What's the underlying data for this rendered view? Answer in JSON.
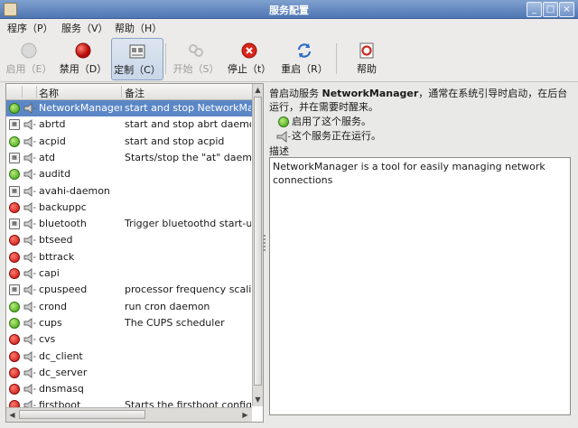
{
  "window": {
    "title": "服务配置",
    "controls": [
      "_",
      "□",
      "×"
    ]
  },
  "menu": [
    {
      "label": "程序（P）"
    },
    {
      "label": "服务（V）"
    },
    {
      "label": "帮助（H）"
    }
  ],
  "toolbar": {
    "enable": {
      "label": "启用（E）",
      "icon": "enable-icon"
    },
    "disable": {
      "label": "禁用（D）",
      "icon": "disable-icon"
    },
    "customize": {
      "label": "定制（C）",
      "icon": "customize-icon"
    },
    "start": {
      "label": "开始（S）",
      "icon": "start-icon"
    },
    "stop": {
      "label": "停止（t）",
      "icon": "stop-icon"
    },
    "restart": {
      "label": "重启（R）",
      "icon": "restart-icon"
    },
    "help": {
      "label": "帮助",
      "icon": "help-icon"
    }
  },
  "list": {
    "headers": {
      "name": "名称",
      "remarks": "备注"
    },
    "rows": [
      {
        "status": "green",
        "name": "NetworkManager",
        "desc": "start and stop NetworkManager",
        "selected": true
      },
      {
        "status": "box",
        "name": "abrtd",
        "desc": "start and stop abrt daemon"
      },
      {
        "status": "green",
        "name": "acpid",
        "desc": "start and stop acpid"
      },
      {
        "status": "box",
        "name": "atd",
        "desc": "Starts/stop the \"at\" daemon"
      },
      {
        "status": "green",
        "name": "auditd",
        "desc": ""
      },
      {
        "status": "box",
        "name": "avahi-daemon",
        "desc": ""
      },
      {
        "status": "red",
        "name": "backuppc",
        "desc": ""
      },
      {
        "status": "box",
        "name": "bluetooth",
        "desc": "Trigger bluetoothd start-up"
      },
      {
        "status": "red",
        "name": "btseed",
        "desc": ""
      },
      {
        "status": "red",
        "name": "bttrack",
        "desc": ""
      },
      {
        "status": "red",
        "name": "capi",
        "desc": ""
      },
      {
        "status": "box",
        "name": "cpuspeed",
        "desc": "processor frequency scaling"
      },
      {
        "status": "green",
        "name": "crond",
        "desc": "run cron daemon"
      },
      {
        "status": "green",
        "name": "cups",
        "desc": "The CUPS scheduler"
      },
      {
        "status": "red",
        "name": "cvs",
        "desc": ""
      },
      {
        "status": "red",
        "name": "dc_client",
        "desc": ""
      },
      {
        "status": "red",
        "name": "dc_server",
        "desc": ""
      },
      {
        "status": "red",
        "name": "dnsmasq",
        "desc": ""
      },
      {
        "status": "red",
        "name": "firstboot",
        "desc": "Starts the firstboot configuration"
      }
    ]
  },
  "details": {
    "intro_prefix": "曾启动服务",
    "service_name": "NetworkManager",
    "intro_suffix": "，通常在系统引导时启动，在后台运行，并在需要时醒来。",
    "enabled_line": "启用了这个服务。",
    "running_line": "这个服务正在运行。",
    "description_label": "描述",
    "description_text": "NetworkManager is a tool for easily managing network connections"
  },
  "colors": {
    "selection": "#5b87c6",
    "titlebar": "#5f84be",
    "running": "#3c9a12",
    "stopped": "#c10f0f"
  }
}
